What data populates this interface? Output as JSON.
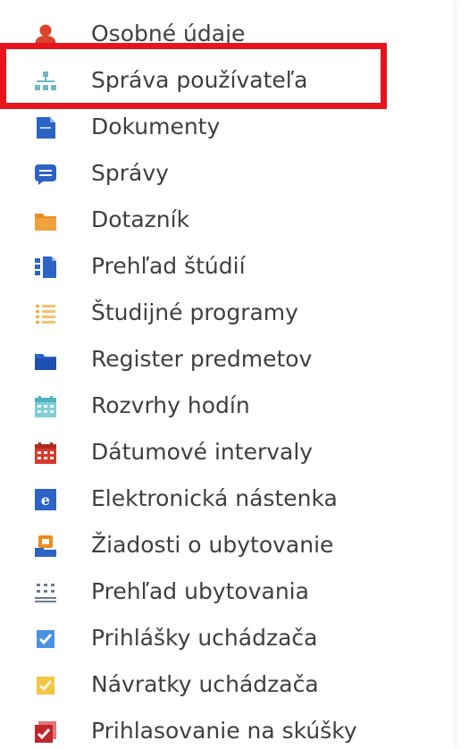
{
  "menu": {
    "items": [
      {
        "label": "Osobné údaje",
        "icon": "user-icon"
      },
      {
        "label": "Správa používateľa",
        "icon": "org-chart-icon"
      },
      {
        "label": "Dokumenty",
        "icon": "document-icon"
      },
      {
        "label": "Správy",
        "icon": "message-icon"
      },
      {
        "label": "Dotazník",
        "icon": "folder-icon"
      },
      {
        "label": "Prehľad štúdií",
        "icon": "study-overview-icon"
      },
      {
        "label": "Študijné programy",
        "icon": "list-icon"
      },
      {
        "label": "Register predmetov",
        "icon": "register-icon"
      },
      {
        "label": "Rozvrhy hodín",
        "icon": "schedule-calendar-icon"
      },
      {
        "label": "Dátumové intervaly",
        "icon": "date-calendar-icon"
      },
      {
        "label": "Elektronická nástenka",
        "icon": "e-board-icon"
      },
      {
        "label": "Žiadosti o ubytovanie",
        "icon": "accommodation-request-icon"
      },
      {
        "label": "Prehľad ubytovania",
        "icon": "accommodation-overview-icon"
      },
      {
        "label": "Prihlášky uchádzača",
        "icon": "application-check-icon"
      },
      {
        "label": "Návratky uchádzača",
        "icon": "return-form-icon"
      },
      {
        "label": "Prihlasovanie na skúšky",
        "icon": "exam-registration-icon"
      }
    ]
  },
  "colors": {
    "highlight_border": "#e8141c",
    "text": "#3f3f3f",
    "user_icon": "#d9442a",
    "org_icon": "#6fb8c4",
    "blue_icon": "#2b63c6",
    "orange_icon": "#e98c1f",
    "calendar_teal": "#7ccfd7",
    "calendar_red": "#d83a2c",
    "checkbox_blue": "#4a90e2",
    "checkbox_yellow": "#f4c542",
    "exam_red": "#c0272d"
  }
}
